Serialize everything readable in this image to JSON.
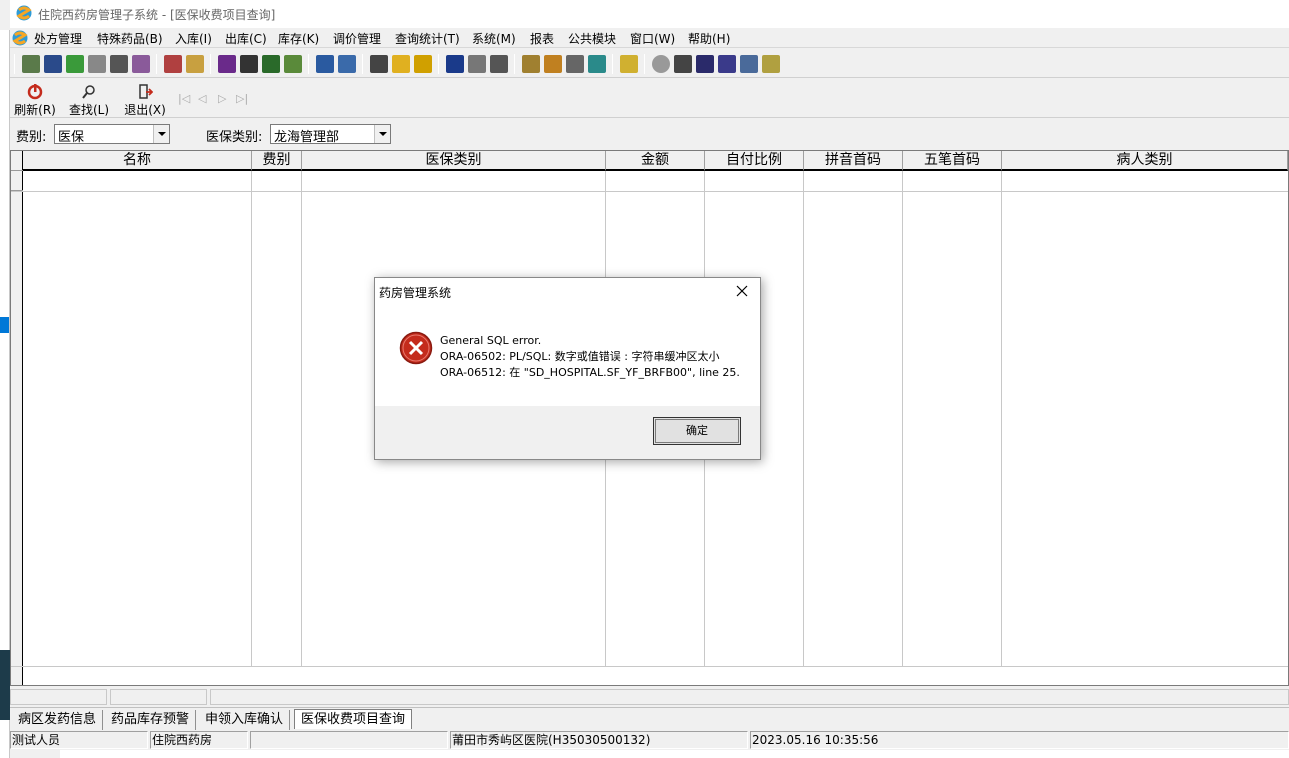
{
  "window": {
    "title": "住院西药房管理子系统 - [医保收费项目查询]"
  },
  "menu": [
    "处方管理",
    "特殊药品(B)",
    "入库(I)",
    "出库(C)",
    "库存(K)",
    "调价管理",
    "查询统计(T)",
    "系统(M)",
    "报表",
    "公共模块",
    "窗口(W)",
    "帮助(H)"
  ],
  "toolbar2": {
    "refresh": "刷新(R)",
    "find": "查找(L)",
    "exit": "退出(X)"
  },
  "filters": {
    "fee_label": "费别:",
    "fee_value": "医保",
    "insurance_label": "医保类别:",
    "insurance_value": "龙海管理部"
  },
  "grid": {
    "columns": [
      "名称",
      "费别",
      "医保类别",
      "金额",
      "自付比例",
      "拼音首码",
      "五笔首码",
      "病人类别"
    ]
  },
  "tabs": [
    "病区发药信息",
    "药品库存预警",
    "申领入库确认",
    "医保收费项目查询"
  ],
  "status": {
    "user": "测试人员",
    "dept": "住院西药房",
    "hospital": "莆田市秀屿区医院(H35030500132)",
    "datetime": "2023.05.16 10:35:56"
  },
  "dialog": {
    "title": "药房管理系统",
    "line1": "General SQL error.",
    "line2": "ORA-06502: PL/SQL: 数字或值错误 :  字符串缓冲区太小",
    "line3": "ORA-06512: 在 \"SD_HOSPITAL.SF_YF_BRFB00\", line 25.",
    "ok": "确定"
  },
  "colors": {
    "error_red": "#c42b1c",
    "selection_blue": "#0078d7"
  }
}
